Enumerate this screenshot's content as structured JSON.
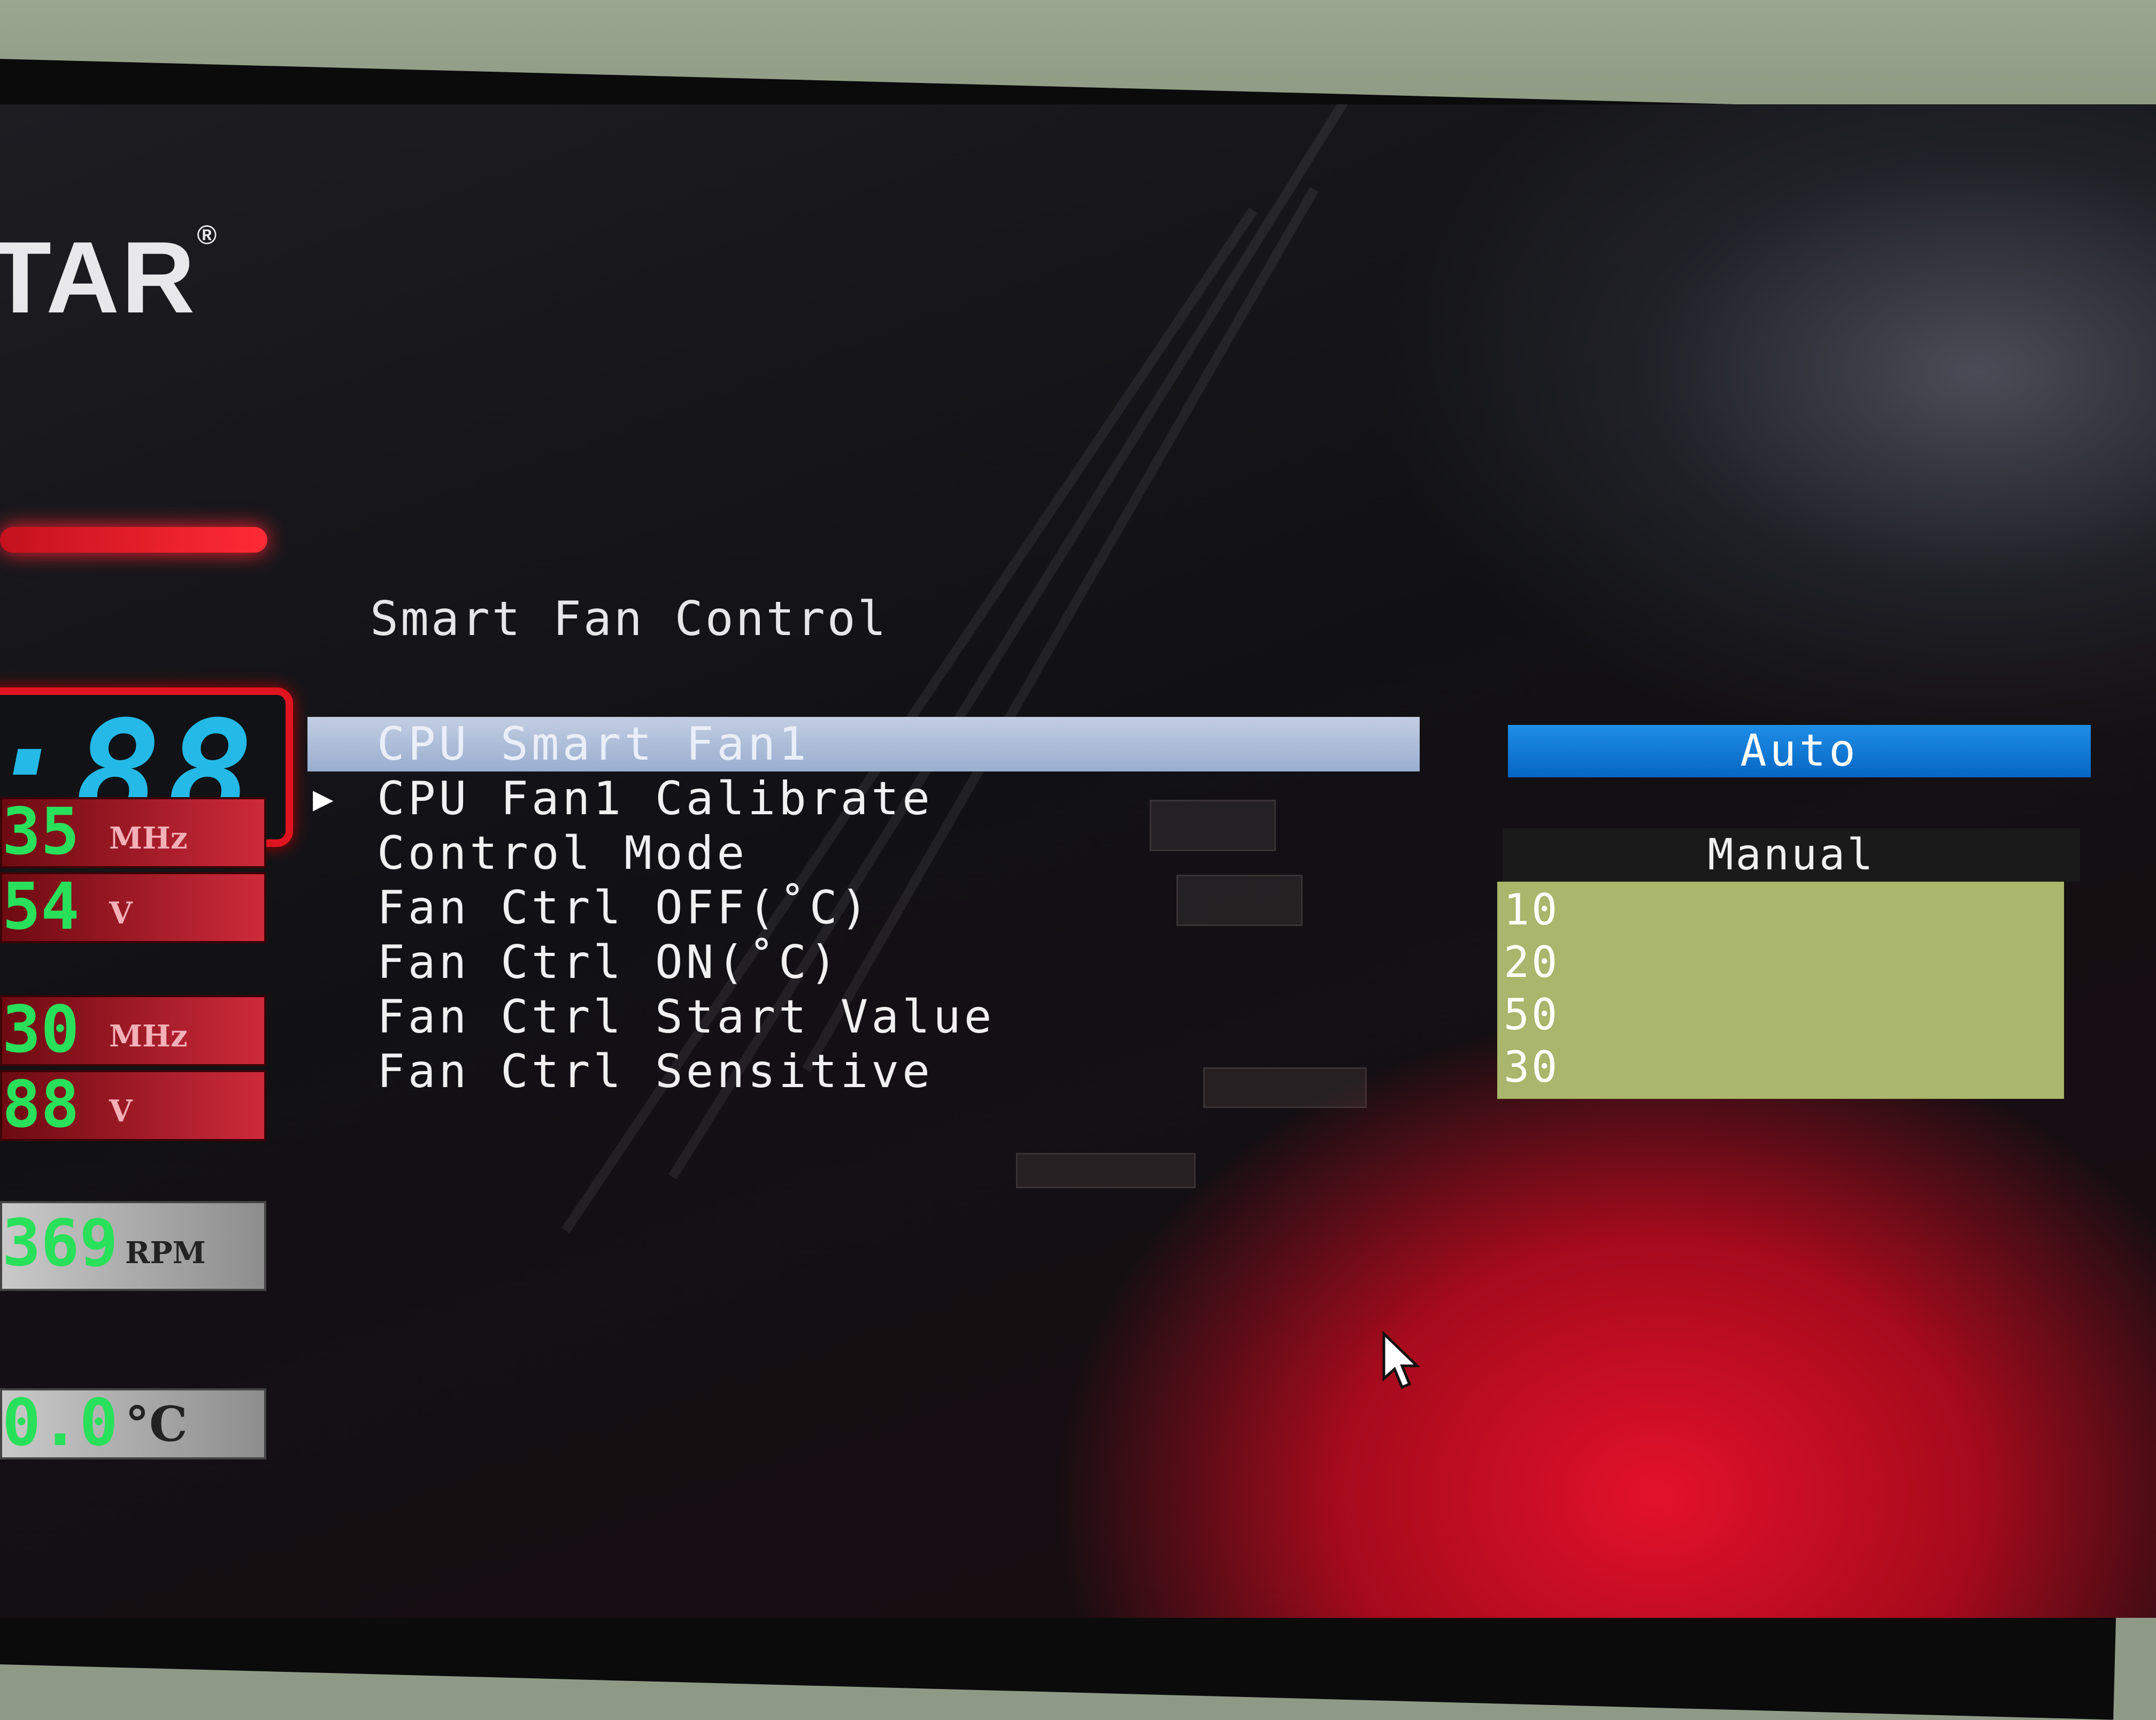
{
  "logo": {
    "text": "TAR",
    "mark": "®"
  },
  "left_panel": {
    "clock": ":88",
    "readouts": [
      {
        "value": "35",
        "unit": "MHz"
      },
      {
        "value": "54",
        "unit": "V"
      },
      {
        "value": "30",
        "unit": "MHz"
      },
      {
        "value": "88",
        "unit": "V"
      },
      {
        "value": "369",
        "unit": "RPM"
      },
      {
        "value": "0.0",
        "unit": "°C"
      }
    ]
  },
  "page": {
    "title": "Smart Fan Control"
  },
  "menu": {
    "items": [
      {
        "label": "CPU Smart Fan1"
      },
      {
        "label": "CPU Fan1 Calibrate"
      },
      {
        "label": "Control Mode"
      },
      {
        "label": "Fan Ctrl OFF(˚C)"
      },
      {
        "label": "Fan Ctrl ON(˚C)"
      },
      {
        "label": "Fan Ctrl Start Value"
      },
      {
        "label": "Fan Ctrl Sensitive"
      }
    ],
    "arrow_icon": "▶"
  },
  "options": {
    "smart_fan_value": "Auto",
    "control_mode_value": "Manual",
    "values": [
      "10",
      "20",
      "50",
      "30"
    ]
  },
  "colors": {
    "selected_bg": "#9aaed0",
    "auto_bg": "#0666c4",
    "value_box_bg": "#a9b66b",
    "readout_green": "#29e05a",
    "clock_cyan": "#24b9e6"
  }
}
